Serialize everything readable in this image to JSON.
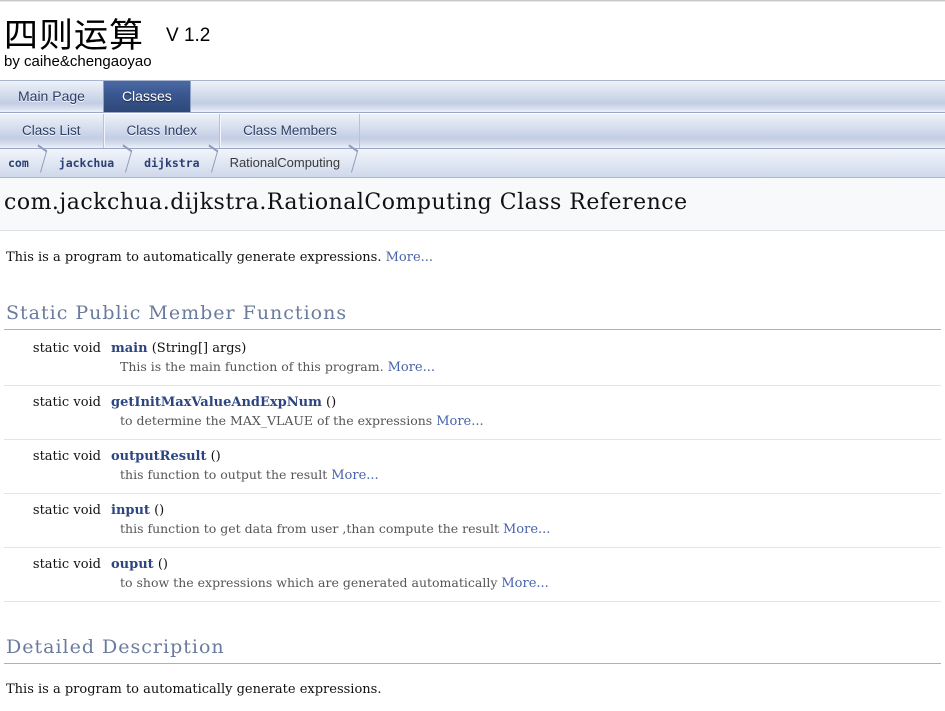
{
  "header": {
    "project_name": "四则运算",
    "project_number": "V 1.2",
    "project_brief": "by caihe&chengaoyao"
  },
  "tabs": {
    "primary": [
      {
        "label": "Main Page",
        "current": false
      },
      {
        "label": "Classes",
        "current": true
      }
    ],
    "secondary": [
      {
        "label": "Class List",
        "current": false
      },
      {
        "label": "Class Index",
        "current": false
      },
      {
        "label": "Class Members",
        "current": false
      }
    ]
  },
  "breadcrumb": [
    {
      "label": "com",
      "style": "code"
    },
    {
      "label": "jackchua",
      "style": "code"
    },
    {
      "label": "dijkstra",
      "style": "code"
    },
    {
      "label": "RationalComputing",
      "style": "plain"
    }
  ],
  "page": {
    "title": "com.jackchua.dijkstra.RationalComputing Class Reference",
    "brief_description": "This is a program to automatically generate expressions.",
    "more_label": "More..."
  },
  "member_section": {
    "heading": "Static Public Member Functions",
    "members": [
      {
        "type": "static void",
        "name": "main",
        "args": "(String[] args)",
        "description": "This is the main function of this program.",
        "more_label": "More..."
      },
      {
        "type": "static void",
        "name": "getInitMaxValueAndExpNum",
        "args": "()",
        "description": "to determine the MAX_VLAUE of the expressions",
        "more_label": "More..."
      },
      {
        "type": "static void",
        "name": "outputResult",
        "args": "()",
        "description": "this function to output the result",
        "more_label": "More..."
      },
      {
        "type": "static void",
        "name": "input",
        "args": "()",
        "description": "this function to get data from user ,than compute the result",
        "more_label": "More..."
      },
      {
        "type": "static void",
        "name": "ouput",
        "args": "()",
        "description": "to show the expressions which are generated automatically",
        "more_label": "More..."
      }
    ]
  },
  "detailed_description": {
    "heading": "Detailed Description",
    "text": "This is a program to automatically generate expressions."
  },
  "colors": {
    "tab_active_bg": "#2d4878",
    "link": "#4864ac",
    "member_name": "#2c4480",
    "section_heading": "#6b7b9c"
  }
}
